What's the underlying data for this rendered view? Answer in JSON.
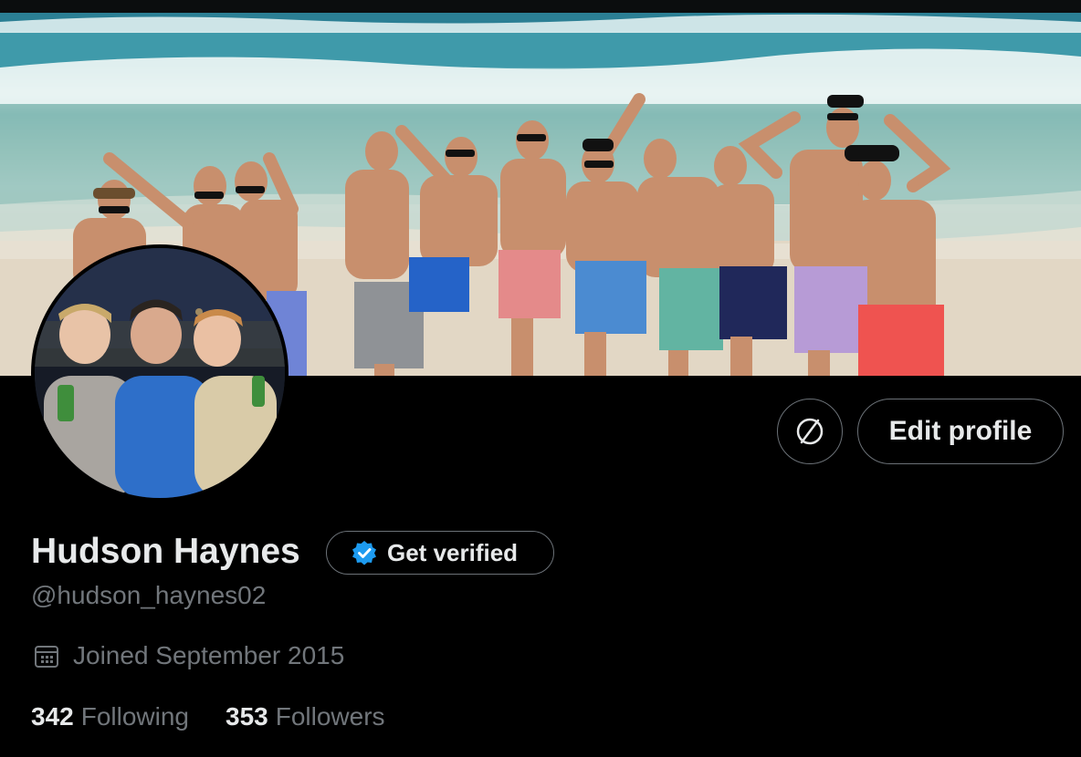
{
  "profile": {
    "display_name": "Hudson Haynes",
    "handle": "@hudson_haynes02",
    "joined": "Joined September 2015",
    "following_count": "342",
    "following_label": "Following",
    "followers_count": "353",
    "followers_label": "Followers"
  },
  "actions": {
    "edit_profile_label": "Edit profile",
    "get_verified_label": "Get verified",
    "icon_button_icon": "slashed-circle-icon"
  },
  "icons": {
    "verified": "verified-badge-icon",
    "calendar": "calendar-icon"
  },
  "colors": {
    "background": "#000000",
    "text_primary": "#e7e9ea",
    "text_secondary": "#71767b",
    "border": "#6b7177",
    "verified_blue": "#1d9bf0"
  }
}
